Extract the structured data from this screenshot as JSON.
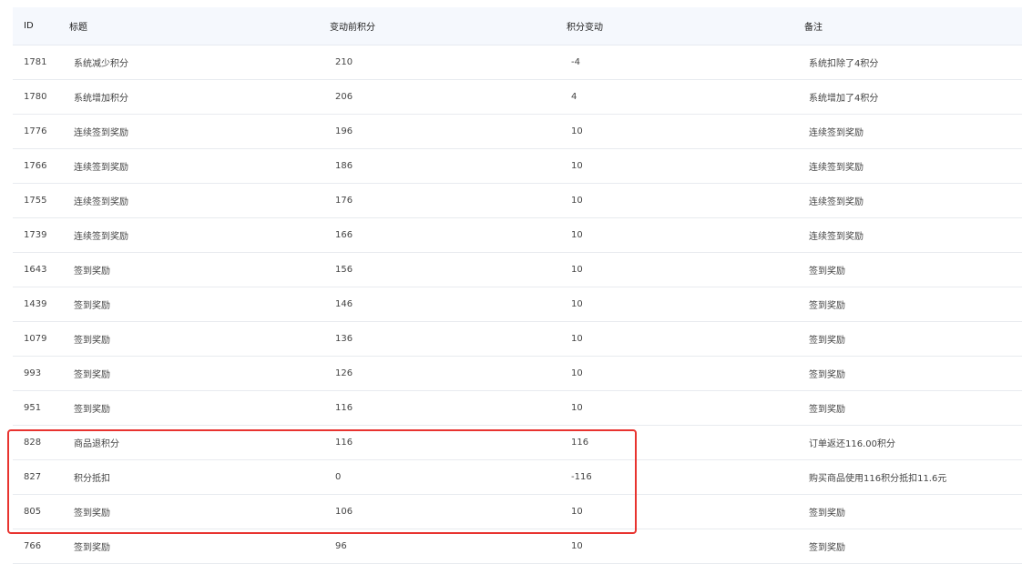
{
  "table": {
    "headers": {
      "id": "ID",
      "title": "标题",
      "before": "变动前积分",
      "delta": "积分变动",
      "note": "备注"
    },
    "rows": [
      {
        "id": "1781",
        "title": "系统减少积分",
        "before": "210",
        "delta": "-4",
        "note": "系统扣除了4积分"
      },
      {
        "id": "1780",
        "title": "系统增加积分",
        "before": "206",
        "delta": "4",
        "note": "系统增加了4积分"
      },
      {
        "id": "1776",
        "title": "连续签到奖励",
        "before": "196",
        "delta": "10",
        "note": "连续签到奖励"
      },
      {
        "id": "1766",
        "title": "连续签到奖励",
        "before": "186",
        "delta": "10",
        "note": "连续签到奖励"
      },
      {
        "id": "1755",
        "title": "连续签到奖励",
        "before": "176",
        "delta": "10",
        "note": "连续签到奖励"
      },
      {
        "id": "1739",
        "title": "连续签到奖励",
        "before": "166",
        "delta": "10",
        "note": "连续签到奖励"
      },
      {
        "id": "1643",
        "title": "签到奖励",
        "before": "156",
        "delta": "10",
        "note": "签到奖励"
      },
      {
        "id": "1439",
        "title": "签到奖励",
        "before": "146",
        "delta": "10",
        "note": "签到奖励"
      },
      {
        "id": "1079",
        "title": "签到奖励",
        "before": "136",
        "delta": "10",
        "note": "签到奖励"
      },
      {
        "id": "993",
        "title": "签到奖励",
        "before": "126",
        "delta": "10",
        "note": "签到奖励"
      },
      {
        "id": "951",
        "title": "签到奖励",
        "before": "116",
        "delta": "10",
        "note": "签到奖励"
      },
      {
        "id": "828",
        "title": "商品退积分",
        "before": "116",
        "delta": "116",
        "note": "订单返还116.00积分"
      },
      {
        "id": "827",
        "title": "积分抵扣",
        "before": "0",
        "delta": "-116",
        "note": "购买商品使用116积分抵扣11.6元"
      },
      {
        "id": "805",
        "title": "签到奖励",
        "before": "106",
        "delta": "10",
        "note": "签到奖励"
      },
      {
        "id": "766",
        "title": "签到奖励",
        "before": "96",
        "delta": "10",
        "note": "签到奖励"
      }
    ]
  },
  "highlight": {
    "color": "#e8332f",
    "rows": [
      "828",
      "827",
      "805"
    ]
  }
}
